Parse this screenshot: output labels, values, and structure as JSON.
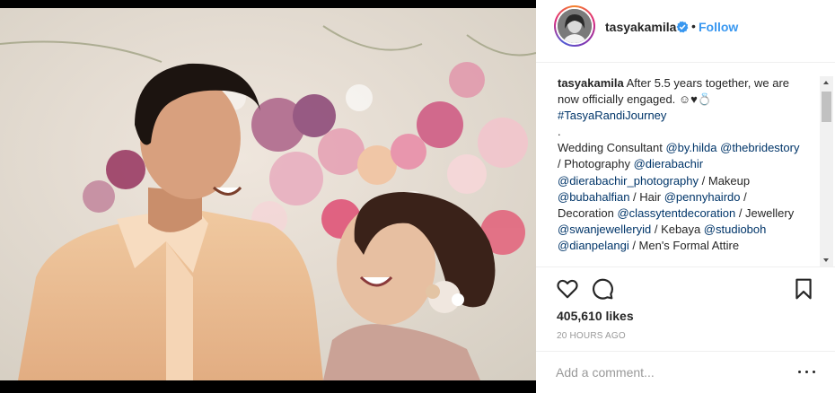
{
  "post": {
    "username": "tasyakamila",
    "follow_label": "Follow",
    "separator": "•",
    "verified_icon": "verified-badge-icon",
    "accent_color": "#3897f0"
  },
  "caption": {
    "username": "tasyakamila",
    "line1": " After 5.5 years together, we are now officially engaged. ☺︎♥︎💍",
    "hashtag": "#TasyaRandiJourney",
    "dot": ".",
    "credits_prefix": "Wedding Consultant ",
    "credits": [
      {
        "tag": "@by.hilda",
        "after": " "
      },
      {
        "tag": "@thebridestory",
        "after": " / Photography "
      },
      {
        "tag": "@dierabachir",
        "after": " "
      },
      {
        "tag": "@dierabachir_photography",
        "after": " / Makeup "
      },
      {
        "tag": "@bubahalfian",
        "after": " / Hair "
      },
      {
        "tag": "@pennyhairdo",
        "after": " / Decoration "
      },
      {
        "tag": "@classytentdecoration",
        "after": " / Jewellery "
      },
      {
        "tag": "@swanjewelleryid",
        "after": " / Kebaya "
      },
      {
        "tag": "@studioboh",
        "after": " "
      },
      {
        "tag": "@dianpelangi",
        "after": " / Men's Formal Attire"
      }
    ]
  },
  "actions": {
    "icons": [
      "heart-icon",
      "comment-icon",
      "bookmark-icon"
    ],
    "likes": "405,610 likes",
    "time": "20 HOURS AGO"
  },
  "comment_box": {
    "placeholder": "Add a comment...",
    "more_icon": "more-options-icon"
  }
}
